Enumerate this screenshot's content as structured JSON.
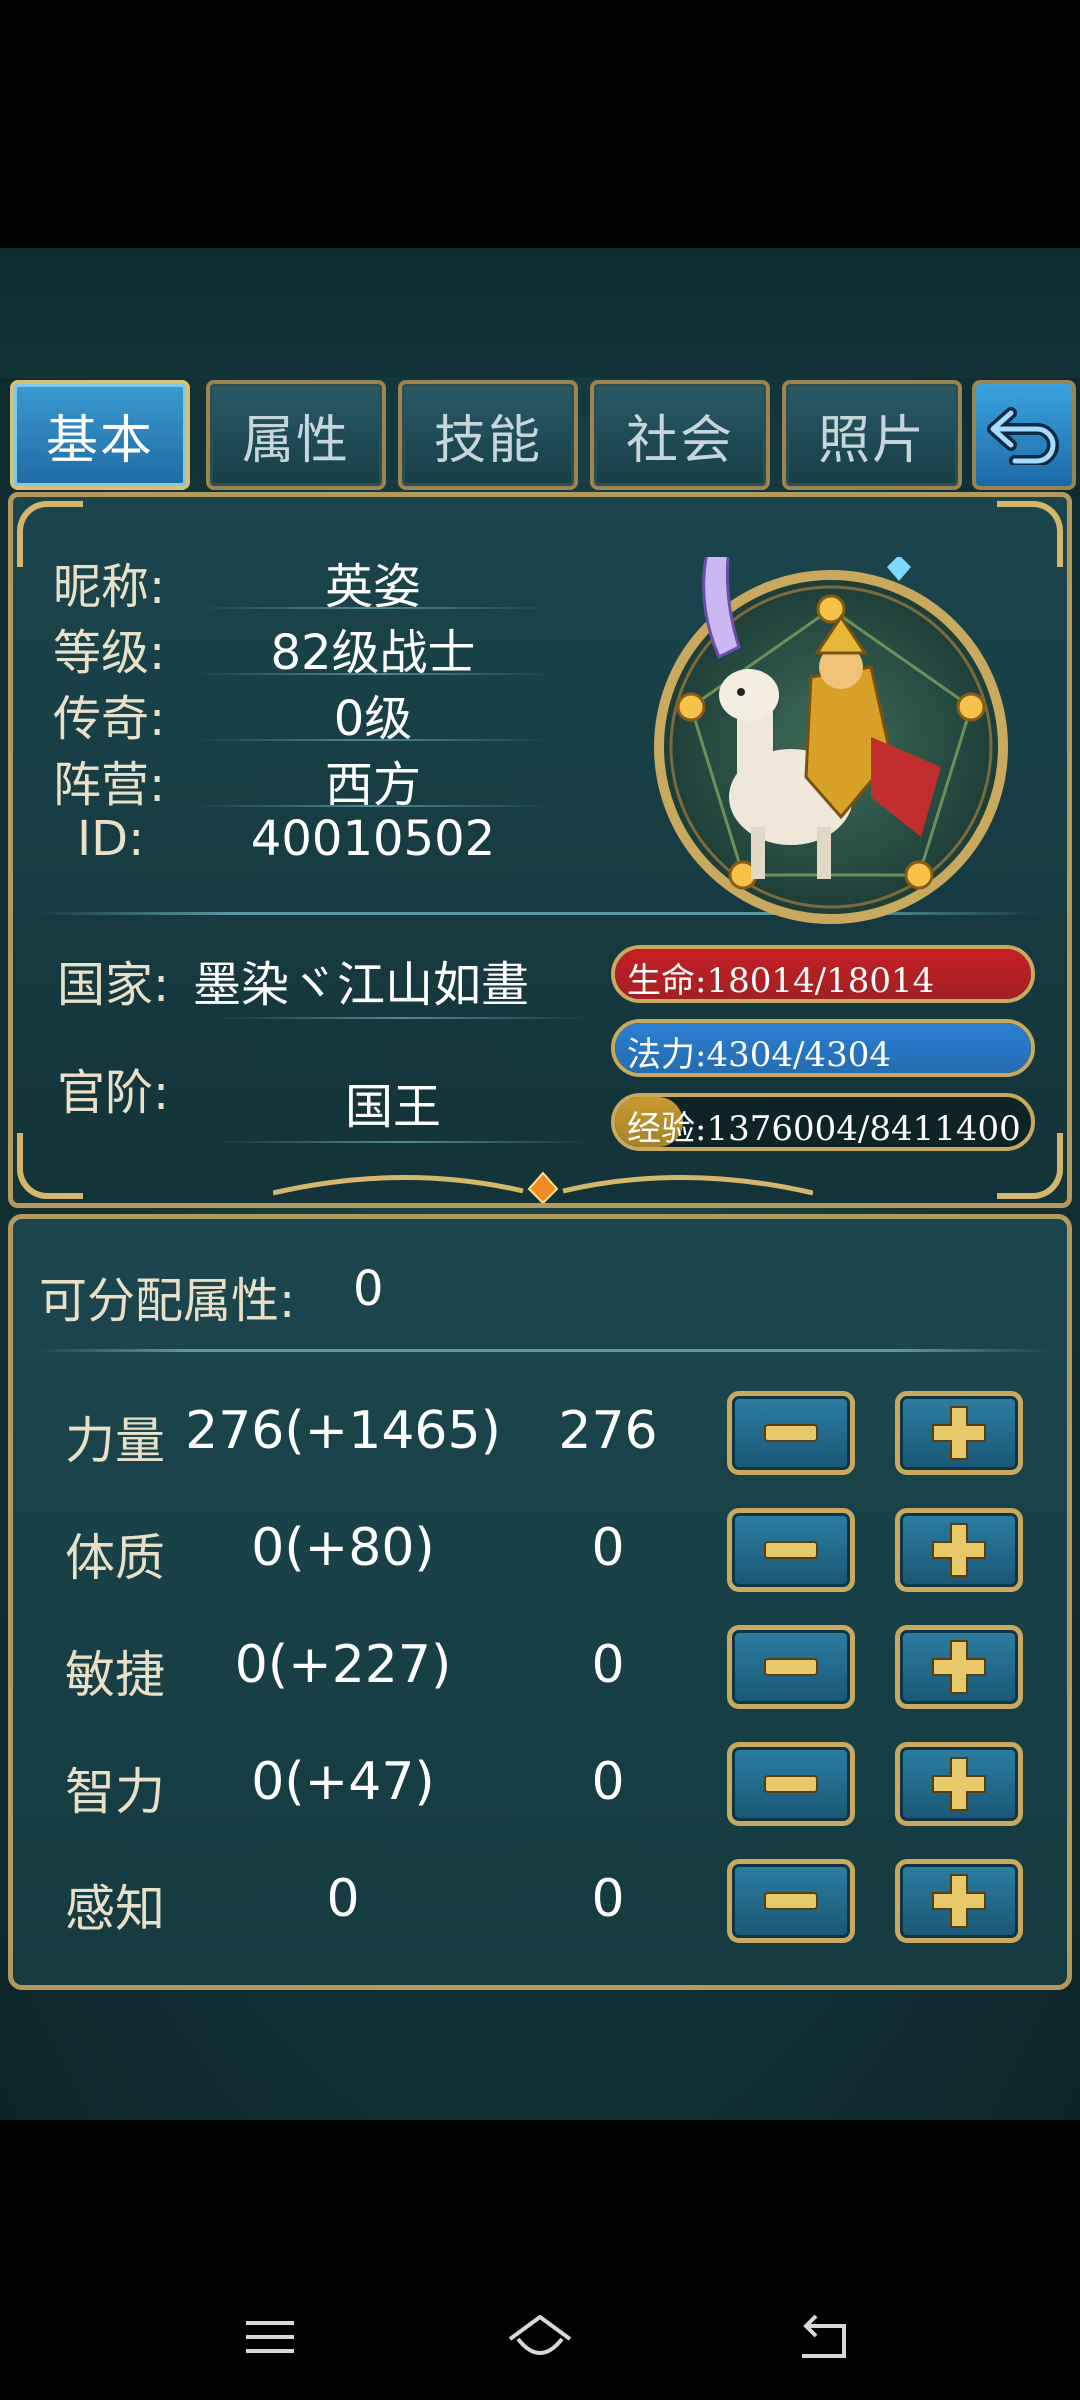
{
  "tabs": [
    {
      "label": "基本",
      "active": true
    },
    {
      "label": "属性",
      "active": false
    },
    {
      "label": "技能",
      "active": false
    },
    {
      "label": "社会",
      "active": false
    },
    {
      "label": "照片",
      "active": false
    }
  ],
  "info": {
    "nickname_label": "昵称:",
    "nickname": "英姿",
    "level_label": "等级:",
    "level": "82级战士",
    "legend_label": "传奇:",
    "legend": "0级",
    "camp_label": "阵营:",
    "camp": "西方",
    "id_label": "ID:",
    "id": "40010502",
    "country_label": "国家:",
    "country": "墨染ヾ江山如畫",
    "rank_label": "官阶:",
    "rank": "国王"
  },
  "bars": {
    "hp": {
      "text": "生命:18014/18014",
      "fraction": 1.0,
      "color": "#c61f24"
    },
    "mp": {
      "text": "法力:4304/4304",
      "fraction": 1.0,
      "color": "#2a7fd4"
    },
    "exp": {
      "text": "经验:1376004/8411400",
      "fraction": 0.164,
      "color": "#c99a2e"
    }
  },
  "attributes": {
    "points_label": "可分配属性:",
    "points_value": "0",
    "rows": [
      {
        "name": "力量",
        "total": "276(+1465)",
        "base": "276"
      },
      {
        "name": "体质",
        "total": "0(+80)",
        "base": "0"
      },
      {
        "name": "敏捷",
        "total": "0(+227)",
        "base": "0"
      },
      {
        "name": "智力",
        "total": "0(+47)",
        "base": "0"
      },
      {
        "name": "感知",
        "total": "0",
        "base": "0"
      }
    ]
  },
  "icons": {
    "back": "back-arrow-icon",
    "minus": "minus-icon",
    "plus": "plus-icon",
    "nav_menu": "menu-icon",
    "nav_home": "home-icon",
    "nav_back": "back-icon"
  }
}
